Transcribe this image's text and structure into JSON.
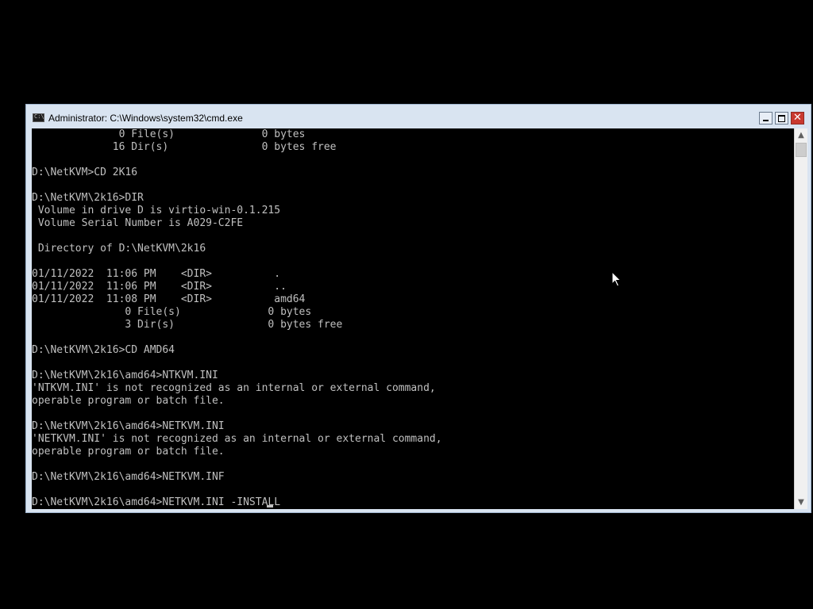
{
  "window": {
    "title": "Administrator: C:\\Windows\\system32\\cmd.exe",
    "icon": "cmd-icon",
    "icon_text": "C:\\",
    "buttons": {
      "minimize": "minimize-icon",
      "maximize": "maximize-icon",
      "close_label": "✕"
    }
  },
  "console": {
    "lines": [
      "              0 File(s)              0 bytes",
      "             16 Dir(s)               0 bytes free",
      "",
      "D:\\NetKVM>CD 2K16",
      "",
      "D:\\NetKVM\\2k16>DIR",
      " Volume in drive D is virtio-win-0.1.215",
      " Volume Serial Number is A029-C2FE",
      "",
      " Directory of D:\\NetKVM\\2k16",
      "",
      "01/11/2022  11:06 PM    <DIR>          .",
      "01/11/2022  11:06 PM    <DIR>          ..",
      "01/11/2022  11:08 PM    <DIR>          amd64",
      "               0 File(s)              0 bytes",
      "               3 Dir(s)               0 bytes free",
      "",
      "D:\\NetKVM\\2k16>CD AMD64",
      "",
      "D:\\NetKVM\\2k16\\amd64>NTKVM.INI",
      "'NTKVM.INI' is not recognized as an internal or external command,",
      "operable program or batch file.",
      "",
      "D:\\NetKVM\\2k16\\amd64>NETKVM.INI",
      "'NETKVM.INI' is not recognized as an internal or external command,",
      "operable program or batch file.",
      "",
      "D:\\NetKVM\\2k16\\amd64>NETKVM.INF",
      "",
      "D:\\NetKVM\\2k16\\amd64>NETKVM.INI -INSTALL"
    ]
  },
  "scrollbar": {
    "up_glyph": "▲",
    "down_glyph": "▼"
  },
  "colors": {
    "console_bg": "#000000",
    "console_text": "#c0c0c0",
    "titlebar_bg": "#d9e4f1",
    "close_button": "#c9392f"
  }
}
